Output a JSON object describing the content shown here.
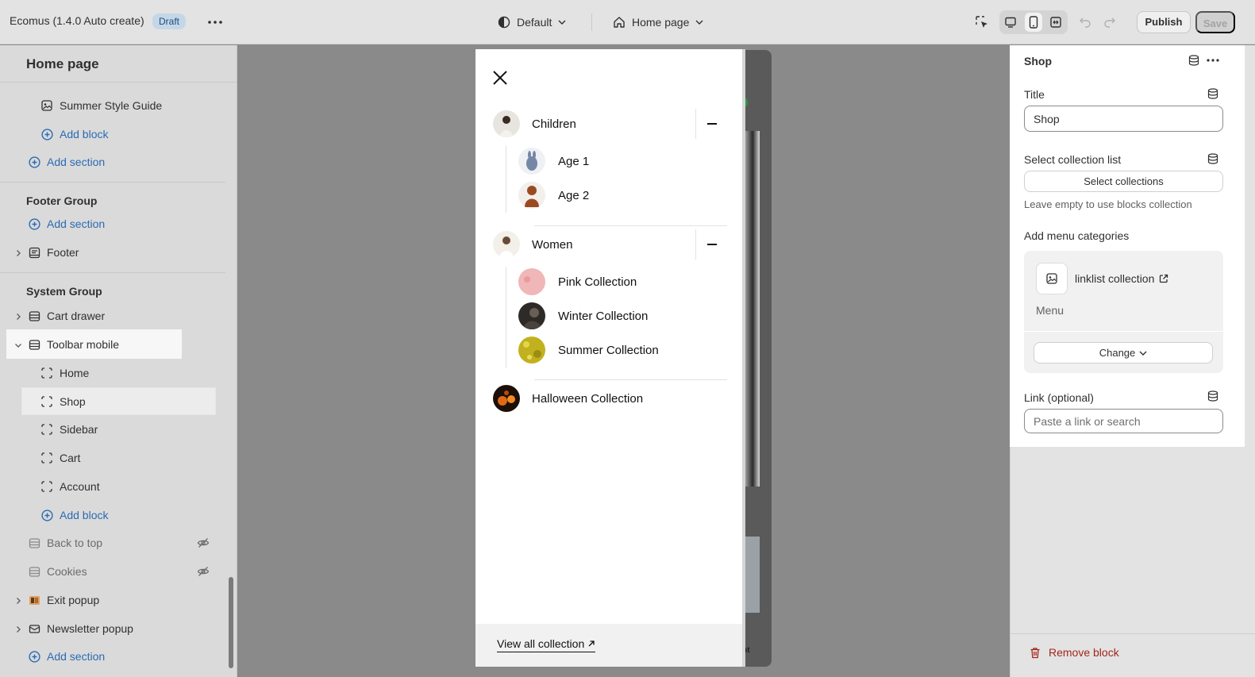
{
  "topbar": {
    "app_title": "Ecomus (1.4.0 Auto create)",
    "status_badge": "Draft",
    "theme_select": "Default",
    "page_select": "Home page",
    "publish_label": "Publish",
    "save_label": "Save"
  },
  "sidebar": {
    "title": "Home page",
    "items": {
      "summer_style_guide": "Summer Style Guide",
      "add_block_1": "Add block",
      "add_section_1": "Add section",
      "footer_group": "Footer Group",
      "add_section_2": "Add section",
      "footer": "Footer",
      "system_group": "System Group",
      "cart_drawer": "Cart drawer",
      "toolbar_mobile": "Toolbar mobile",
      "home": "Home",
      "shop": "Shop",
      "sidebar": "Sidebar",
      "cart": "Cart",
      "account": "Account",
      "add_block_2": "Add block",
      "back_to_top": "Back to top",
      "cookies": "Cookies",
      "exit_popup": "Exit popup",
      "newsletter_popup": "Newsletter popup",
      "add_section_3": "Add section"
    }
  },
  "drawer": {
    "categories": [
      {
        "label": "Children",
        "children": [
          "Age 1",
          "Age 2"
        ]
      },
      {
        "label": "Women",
        "children": [
          "Pink Collection",
          "Winter Collection",
          "Summer Collection"
        ]
      },
      {
        "label": "Halloween Collection"
      }
    ],
    "view_all": "View all collection",
    "phone_partial_text": "nt"
  },
  "panel": {
    "title": "Shop",
    "title_label": "Title",
    "title_value": "Shop",
    "select_collection_label": "Select collection list",
    "select_collections_btn": "Select collections",
    "select_collection_help": "Leave empty to use blocks collection",
    "menu_categories_label": "Add menu categories",
    "menu_link_label": "linklist collection",
    "menu_text": "Menu",
    "change_btn": "Change",
    "link_label": "Link (optional)",
    "link_placeholder": "Paste a link or search",
    "remove_block": "Remove block"
  },
  "colors": {
    "accent_link": "#2a6bb3",
    "danger": "#a3261c",
    "badge_bg": "#c4d7e8"
  }
}
